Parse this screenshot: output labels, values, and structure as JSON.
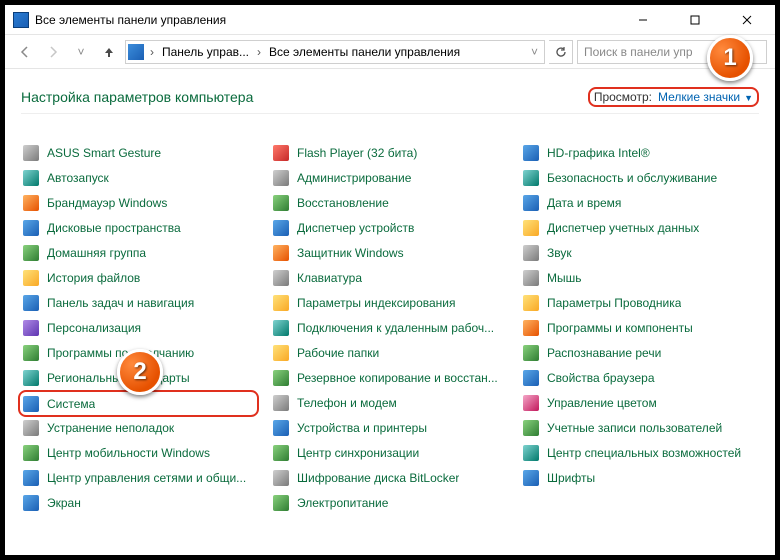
{
  "window": {
    "title": "Все элементы панели управления"
  },
  "nav": {
    "crumb1": "Панель управ...",
    "crumb2": "Все элементы панели управления",
    "search_placeholder": "Поиск в панели упр"
  },
  "header": {
    "title": "Настройка параметров компьютера",
    "view_label": "Просмотр:",
    "view_value": "Мелкие значки"
  },
  "annotations": {
    "badge1": "1",
    "badge2": "2"
  },
  "items": [
    {
      "label": "ASUS Smart Gesture",
      "iconClass": "c-gray"
    },
    {
      "label": "Автозапуск",
      "iconClass": "c-teal"
    },
    {
      "label": "Брандмауэр Windows",
      "iconClass": "c-orange"
    },
    {
      "label": "Дисковые пространства",
      "iconClass": "c-blue"
    },
    {
      "label": "Домашняя группа",
      "iconClass": "c-green"
    },
    {
      "label": "История файлов",
      "iconClass": "c-yellow"
    },
    {
      "label": "Панель задач и навигация",
      "iconClass": "c-blue"
    },
    {
      "label": "Персонализация",
      "iconClass": "c-violet"
    },
    {
      "label": "Программы по умолчанию",
      "iconClass": "c-green"
    },
    {
      "label": "Региональные стандарты",
      "iconClass": "c-teal"
    },
    {
      "label": "Система",
      "iconClass": "c-blue",
      "highlight": true
    },
    {
      "label": "Устранение неполадок",
      "iconClass": "c-gray"
    },
    {
      "label": "Центр мобильности Windows",
      "iconClass": "c-green"
    },
    {
      "label": "Центр управления сетями и общи...",
      "iconClass": "c-blue"
    },
    {
      "label": "Flash Player (32 бита)",
      "iconClass": "c-red"
    },
    {
      "label": "Администрирование",
      "iconClass": "c-gray"
    },
    {
      "label": "Восстановление",
      "iconClass": "c-green"
    },
    {
      "label": "Диспетчер устройств",
      "iconClass": "c-blue"
    },
    {
      "label": "Защитник Windows",
      "iconClass": "c-orange"
    },
    {
      "label": "Клавиатура",
      "iconClass": "c-gray"
    },
    {
      "label": "Параметры индексирования",
      "iconClass": "c-yellow"
    },
    {
      "label": "Подключения к удаленным рабоч...",
      "iconClass": "c-teal"
    },
    {
      "label": "Рабочие папки",
      "iconClass": "c-yellow"
    },
    {
      "label": "Резервное копирование и восстан...",
      "iconClass": "c-green"
    },
    {
      "label": "Телефон и модем",
      "iconClass": "c-gray"
    },
    {
      "label": "Устройства и принтеры",
      "iconClass": "c-blue"
    },
    {
      "label": "Центр синхронизации",
      "iconClass": "c-green"
    },
    {
      "label": "Шифрование диска BitLocker",
      "iconClass": "c-gray"
    },
    {
      "label": "HD-графика Intel®",
      "iconClass": "c-blue"
    },
    {
      "label": "Безопасность и обслуживание",
      "iconClass": "c-teal"
    },
    {
      "label": "Дата и время",
      "iconClass": "c-blue"
    },
    {
      "label": "Диспетчер учетных данных",
      "iconClass": "c-yellow"
    },
    {
      "label": "Звук",
      "iconClass": "c-gray"
    },
    {
      "label": "Мышь",
      "iconClass": "c-gray"
    },
    {
      "label": "Параметры Проводника",
      "iconClass": "c-yellow"
    },
    {
      "label": "Программы и компоненты",
      "iconClass": "c-orange"
    },
    {
      "label": "Распознавание речи",
      "iconClass": "c-green"
    },
    {
      "label": "Свойства браузера",
      "iconClass": "c-blue"
    },
    {
      "label": "Управление цветом",
      "iconClass": "c-pink"
    },
    {
      "label": "Учетные записи пользователей",
      "iconClass": "c-green"
    },
    {
      "label": "Центр специальных возможностей",
      "iconClass": "c-teal"
    },
    {
      "label": "Шрифты",
      "iconClass": "c-blue"
    }
  ],
  "extraItems": [
    {
      "label": "Экран",
      "iconClass": "c-blue"
    },
    {
      "label": "Электропитание",
      "iconClass": "c-green"
    }
  ]
}
